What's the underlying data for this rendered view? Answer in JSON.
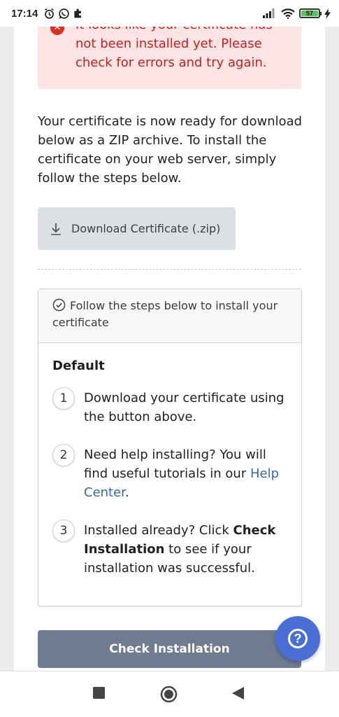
{
  "status_bar": {
    "time": "17:14",
    "battery_level": "57",
    "icons_left": [
      "alarm-icon",
      "whatsapp-icon",
      "puzzle-icon"
    ],
    "icons_right": [
      "signal-icon",
      "wifi-icon",
      "battery-icon",
      "charging-icon"
    ]
  },
  "alert": {
    "text": "It looks like your certificate has not been installed yet. Please check for errors and try again.",
    "icon": "error-icon",
    "color": "#c5221f"
  },
  "intro": {
    "text": "Your certificate is now ready for download below as a ZIP archive. To install the certificate on your web server, simply follow the steps below."
  },
  "download_button": {
    "label": "Download Certificate (.zip)",
    "icon": "download-arrow-icon"
  },
  "steps_card": {
    "header": "Follow the steps below to install your certificate",
    "title": "Default",
    "steps": [
      {
        "number": "1",
        "text": "Download your certificate using the button above."
      },
      {
        "number": "2",
        "text_before": "Need help installing? You will find useful tutorials in our ",
        "link": "Help Center",
        "text_after": "."
      },
      {
        "number": "3",
        "text_before": "Installed already? Click ",
        "bold": "Check Installation",
        "text_after": " to see if your installation was successful."
      }
    ]
  },
  "check_button": {
    "label": "Check Installation",
    "color": "#6f7b91"
  },
  "help_fab": {
    "icon": "help-question-icon",
    "glyph": "?",
    "color": "#4a6fd4"
  },
  "nav_bar": {
    "buttons": [
      "recent-apps-icon",
      "home-icon",
      "back-icon"
    ]
  }
}
